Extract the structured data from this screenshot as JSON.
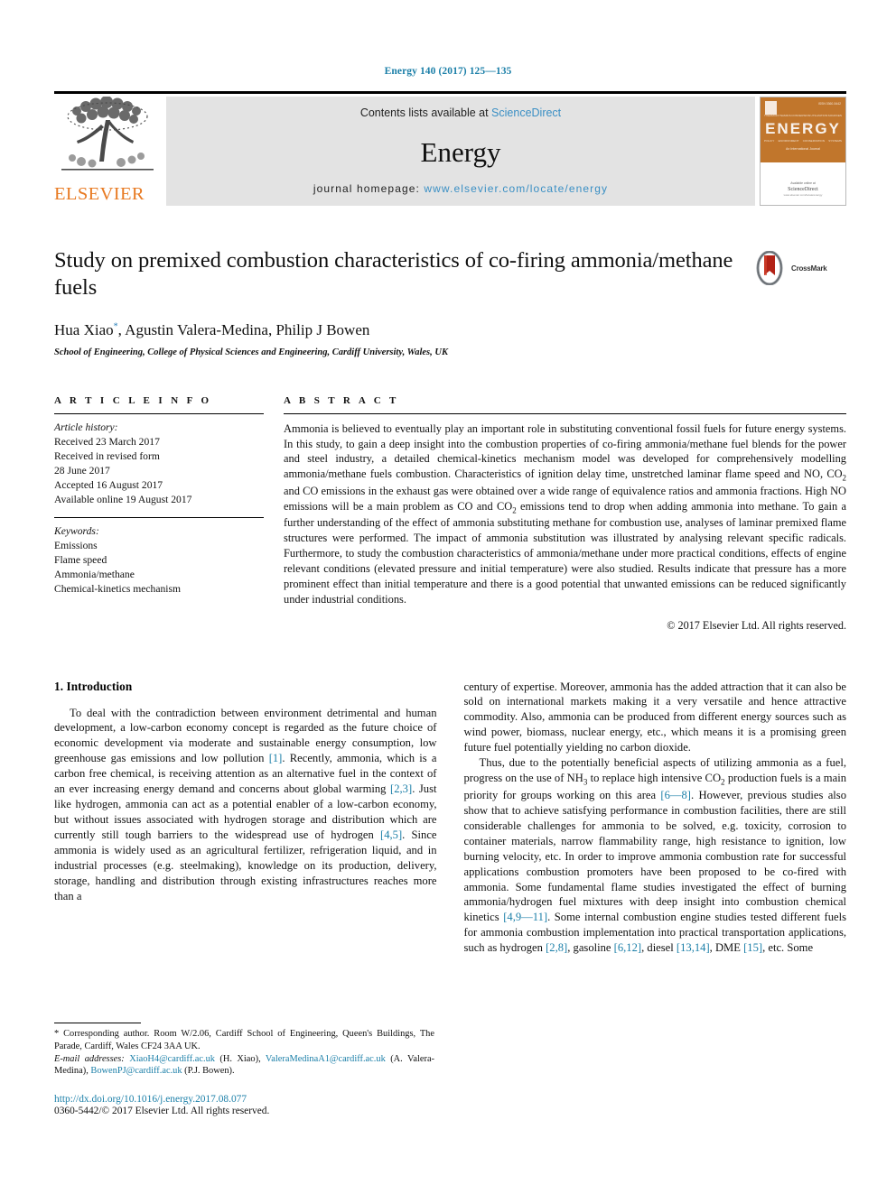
{
  "running_head": "Energy 140 (2017) 125—135",
  "masthead": {
    "publisher": "ELSEVIER",
    "contents_prefix": "Contents lists available at ",
    "contents_link": "ScienceDirect",
    "journal_name": "Energy",
    "homepage_prefix": "journal homepage: ",
    "homepage_url": "www.elsevier.com/locate/energy",
    "cover": {
      "title": "ENERGY",
      "issue": "ISSN 0360-5442",
      "tagline": "An International Journal",
      "labels_top": [
        "THERMODYNAMICS",
        "CONVERSION",
        "UTILIZATION",
        "SOURCES"
      ],
      "labels_bottom": [
        "POLICY",
        "ENVIRONMENT",
        "CONSERVATION",
        "SYSTEMS"
      ],
      "publisher_note": "Available online at",
      "publisher_logo": "ScienceDirect",
      "publisher_url": "www.elsevier.com/locate/energy"
    }
  },
  "article": {
    "title": "Study on premixed combustion characteristics of co-firing ammonia/methane fuels",
    "authors_plain": "Hua Xiao",
    "authors_rest": ", Agustin Valera-Medina, Philip J Bowen",
    "corresponding_marker": "*",
    "affiliation": "School of Engineering, College of Physical Sciences and Engineering, Cardiff University, Wales, UK",
    "crossmark_label": "CrossMark"
  },
  "article_info": {
    "heading": "A R T I C L E  I N F O",
    "history_label": "Article history:",
    "history": [
      "Received 23 March 2017",
      "Received in revised form",
      "28 June 2017",
      "Accepted 16 August 2017",
      "Available online 19 August 2017"
    ],
    "keywords_label": "Keywords:",
    "keywords": [
      "Emissions",
      "Flame speed",
      "Ammonia/methane",
      "Chemical-kinetics mechanism"
    ]
  },
  "abstract": {
    "heading": "A B S T R A C T",
    "text": "Ammonia is believed to eventually play an important role in substituting conventional fossil fuels for future energy systems. In this study, to gain a deep insight into the combustion properties of co-firing ammonia/methane fuel blends for the power and steel industry, a detailed chemical-kinetics mechanism model was developed for comprehensively modelling ammonia/methane fuels combustion. Characteristics of ignition delay time, unstretched laminar flame speed and NO, CO2 and CO emissions in the exhaust gas were obtained over a wide range of equivalence ratios and ammonia fractions. High NO emissions will be a main problem as CO and CO2 emissions tend to drop when adding ammonia into methane. To gain a further understanding of the effect of ammonia substituting methane for combustion use, analyses of laminar premixed flame structures were performed. The impact of ammonia substitution was illustrated by analysing relevant specific radicals. Furthermore, to study the combustion characteristics of ammonia/methane under more practical conditions, effects of engine relevant conditions (elevated pressure and initial temperature) were also studied. Results indicate that pressure has a more prominent effect than initial temperature and there is a good potential that unwanted emissions can be reduced significantly under industrial conditions.",
    "copyright": "© 2017 Elsevier Ltd. All rights reserved."
  },
  "introduction": {
    "heading": "1. Introduction",
    "left_paragraph_1": "To deal with the contradiction between environment detrimental and human development, a low-carbon economy concept is regarded as the future choice of economic development via moderate and sustainable energy consumption, low greenhouse gas emissions and low pollution [1]. Recently, ammonia, which is a carbon free chemical, is receiving attention as an alternative fuel in the context of an ever increasing energy demand and concerns about global warming [2,3]. Just like hydrogen, ammonia can act as a potential enabler of a low-carbon economy, but without issues associated with hydrogen storage and distribution which are currently still tough barriers to the widespread use of hydrogen [4,5]. Since ammonia is widely used as an agricultural fertilizer, refrigeration liquid, and in industrial processes (e.g. steelmaking), knowledge on its production, delivery, storage, handling and distribution through existing infrastructures reaches more than a",
    "right_paragraph_1": "century of expertise. Moreover, ammonia has the added attraction that it can also be sold on international markets making it a very versatile and hence attractive commodity. Also, ammonia can be produced from different energy sources such as wind power, biomass, nuclear energy, etc., which means it is a promising green future fuel potentially yielding no carbon dioxide.",
    "right_paragraph_2": "Thus, due to the potentially beneficial aspects of utilizing ammonia as a fuel, progress on the use of NH3 to replace high intensive CO2 production fuels is a main priority for groups working on this area [6—8]. However, previous studies also show that to achieve satisfying performance in combustion facilities, there are still considerable challenges for ammonia to be solved, e.g. toxicity, corrosion to container materials, narrow flammability range, high resistance to ignition, low burning velocity, etc. In order to improve ammonia combustion rate for successful applications combustion promoters have been proposed to be co-fired with ammonia. Some fundamental flame studies investigated the effect of burning ammonia/hydrogen fuel mixtures with deep insight into combustion chemical kinetics [4,9—11]. Some internal combustion engine studies tested different fuels for ammonia combustion implementation into practical transportation applications, such as hydrogen [2,8], gasoline [6,12], diesel [13,14], DME [15], etc. Some"
  },
  "footnote": {
    "corresponding": "* Corresponding author. Room W/2.06, Cardiff School of Engineering, Queen's Buildings, The Parade, Cardiff, Wales CF24 3AA UK.",
    "emails_label": "E-mail addresses:",
    "email_1": "XiaoH4@cardiff.ac.uk",
    "email_1_name": "(H. Xiao),",
    "email_2": "ValeraMedinaA1@cardiff.ac.uk",
    "email_2_name": "(A. Valera-Medina),",
    "email_3": "BowenPJ@cardiff.ac.uk",
    "email_3_name": "(P.J. Bowen)."
  },
  "doi": "http://dx.doi.org/10.1016/j.energy.2017.08.077",
  "issn_line": "0360-5442/© 2017 Elsevier Ltd. All rights reserved.",
  "colors": {
    "link": "#1b7fa8",
    "elsevier_orange": "#E87A22",
    "band_gray": "#e3e3e3"
  }
}
